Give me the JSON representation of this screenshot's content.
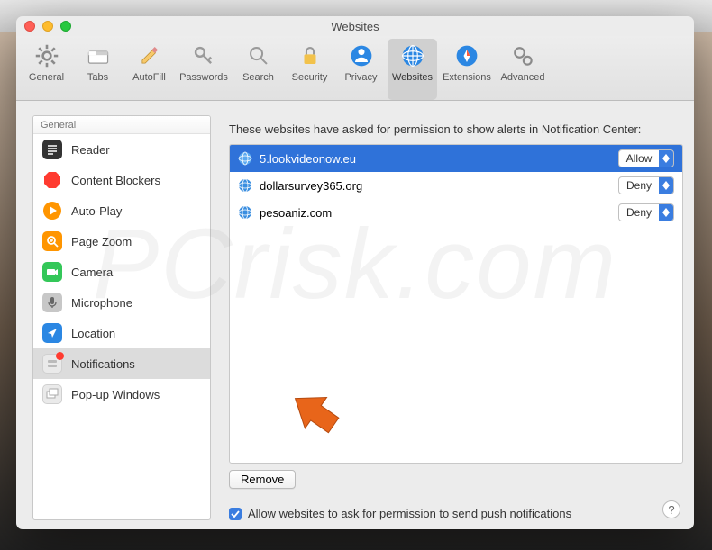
{
  "window": {
    "title": "Websites"
  },
  "toolbar": [
    {
      "label": "General"
    },
    {
      "label": "Tabs"
    },
    {
      "label": "AutoFill"
    },
    {
      "label": "Passwords"
    },
    {
      "label": "Search"
    },
    {
      "label": "Security"
    },
    {
      "label": "Privacy"
    },
    {
      "label": "Websites"
    },
    {
      "label": "Extensions"
    },
    {
      "label": "Advanced"
    }
  ],
  "sidebar": {
    "header": "General",
    "items": [
      {
        "label": "Reader"
      },
      {
        "label": "Content Blockers"
      },
      {
        "label": "Auto-Play"
      },
      {
        "label": "Page Zoom"
      },
      {
        "label": "Camera"
      },
      {
        "label": "Microphone"
      },
      {
        "label": "Location"
      },
      {
        "label": "Notifications"
      },
      {
        "label": "Pop-up Windows"
      }
    ]
  },
  "main": {
    "blurb": "These websites have asked for permission to show alerts in Notification Center:",
    "sites": [
      {
        "name": "5.lookvideonow.eu",
        "perm": "Allow"
      },
      {
        "name": "dollarsurvey365.org",
        "perm": "Deny"
      },
      {
        "name": "pesoaniz.com",
        "perm": "Deny"
      }
    ],
    "remove": "Remove",
    "allow_label": "Allow websites to ask for permission to send push notifications"
  },
  "watermark": "PCrisk.com",
  "help": "?"
}
